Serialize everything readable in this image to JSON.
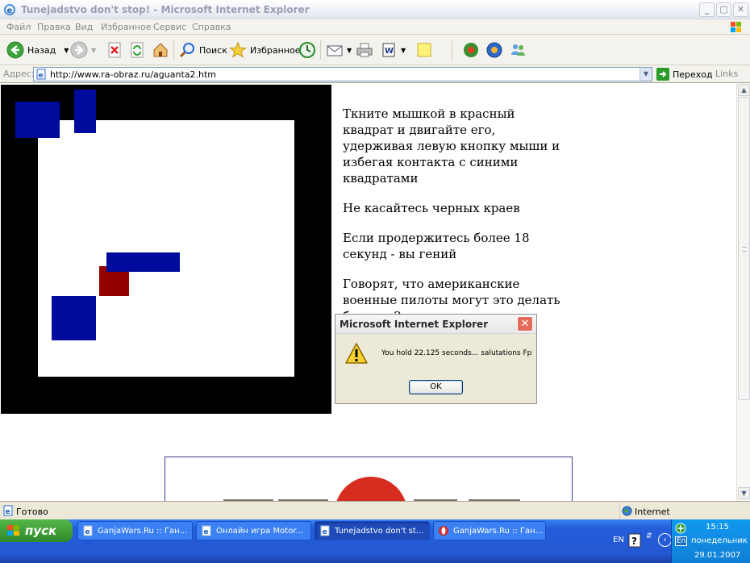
{
  "window": {
    "title": "Tunejadstvo don't stop! - Microsoft Internet Explorer"
  },
  "menu": {
    "items": [
      "Файл",
      "Правка",
      "Вид",
      "Избранное",
      "Сервис",
      "Справка"
    ]
  },
  "toolbar": {
    "back_label": "Назад",
    "search_label": "Поиск",
    "favorites_label": "Избранное"
  },
  "address_bar": {
    "label": "Адрес:",
    "url": "http://www.ra-obraz.ru/aguanta2.htm",
    "go_label": "Переход",
    "links_label": "Links"
  },
  "page": {
    "instructions": [
      "Ткните мышкой в красный квадрат и двигайте его, удерживая левую кнопку мыши и избегая контакта с синими квадратами",
      "Не касайтесь черных краев",
      "Если продержитесь более 18 секунд - вы гений",
      "Говорят, что американские военные пилоты могут это делать больше 2 минут"
    ]
  },
  "dialog": {
    "title": "Microsoft Internet Explorer",
    "message": "You hold 22.125 seconds... salutations Fp",
    "ok_label": "OK"
  },
  "status_bar": {
    "status": "Готово",
    "zone": "Internet"
  },
  "taskbar": {
    "start_label": "пуск",
    "tasks": [
      "GanjaWars.Ru :: Ган...",
      "Онлайн игра Motor...",
      "Tunejadstvo don't st...",
      "GanjaWars.Ru :: Ган..."
    ],
    "lang": "EN",
    "tray_lang": "En",
    "time": "15:15",
    "day": "понедельник",
    "date": "29.01.2007"
  },
  "colors": {
    "blue_block": "#000b9e",
    "red_block": "#930000",
    "board_border": "#000000"
  }
}
